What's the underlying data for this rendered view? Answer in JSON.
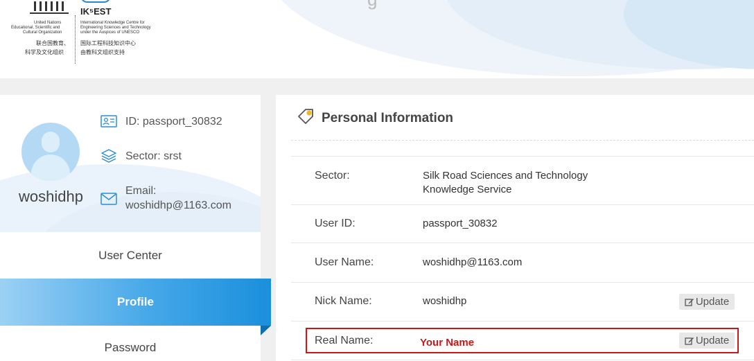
{
  "header": {
    "unesco_lines": [
      "United Nations",
      "Educational, Scientific and",
      "Cultural Organization"
    ],
    "unesco_cn": [
      "联合国教育、",
      "科学及文化组织"
    ],
    "ikcest_name": "IK⁵EST",
    "ikcest_lines": [
      "International Knowledge Centre for",
      "Engineering Sciences and Technology",
      "under the Auspices of UNESCO"
    ],
    "ikcest_cn": [
      "国际工程科技知识中心",
      "由教科文组织支持"
    ],
    "partial_title_glyph": "g"
  },
  "profile": {
    "username": "woshidhp",
    "id_text": "ID: passport_30832",
    "sector_text": "Sector: srst",
    "email_label": "Email:",
    "email_value": "woshidhp@1163.com"
  },
  "menu": {
    "items": [
      {
        "label": "User Center"
      },
      {
        "label": "Profile",
        "active": true
      },
      {
        "label": "Password"
      }
    ]
  },
  "personal_info": {
    "title": "Personal Information",
    "fields": [
      {
        "label": "Sector:",
        "value_line1": "Silk Road Sciences and Technology",
        "value_line2": "Knowledge Service"
      },
      {
        "label": "User ID:",
        "value": "passport_30832"
      },
      {
        "label": "User Name:",
        "value": "woshidhp@1163.com"
      },
      {
        "label": "Nick Name:",
        "value": "woshidhp",
        "button": "Update"
      },
      {
        "label": "Real Name:",
        "value": "Your Name",
        "button": "Update"
      }
    ]
  },
  "colors": {
    "accent": "#1a8fdc",
    "highlight": "#c91717"
  }
}
